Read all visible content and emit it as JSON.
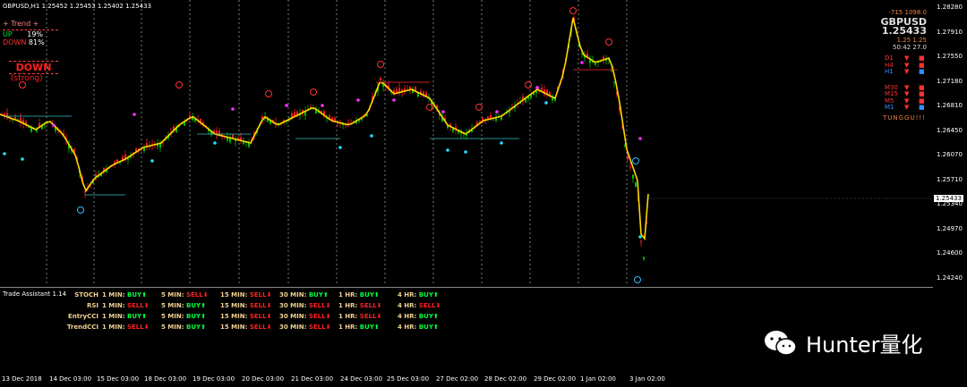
{
  "window_title": "GBPUSD,H1 1.25452 1.25453 1.25402 1.25433",
  "trend_panel": {
    "header": "+   Trend   +",
    "up_label": "UP",
    "up_value": "19%",
    "down_label": "DOWN",
    "down_value": "81%",
    "signal": "DOWN",
    "strength": "(strong)"
  },
  "symbol_panel": {
    "top_left": "-715",
    "top_right": "1098.0",
    "symbol": "GBPUSD",
    "price": "1.25433",
    "mid_left": "1.25",
    "mid_right": "1.25",
    "time_left": "50:42",
    "time_right": "27.0",
    "brand": "TUNGGU!!!"
  },
  "timeframes": [
    {
      "tf": "D1",
      "color": "#ff3030"
    },
    {
      "tf": "H4",
      "color": "#ff3030"
    },
    {
      "tf": "H1",
      "color": "#3090ff"
    },
    {
      "tf": "M30",
      "color": "#ff3030"
    },
    {
      "tf": "M15",
      "color": "#ff3030"
    },
    {
      "tf": "M5",
      "color": "#ff3030"
    },
    {
      "tf": "M1",
      "color": "#3090ff"
    }
  ],
  "price_axis": [
    "1.28280",
    "1.27910",
    "1.27550",
    "1.27180",
    "1.26810",
    "1.26450",
    "1.26070",
    "1.25710",
    "1.25340",
    "1.24970",
    "1.24600",
    "1.24240"
  ],
  "current_price": "1.25433",
  "time_axis": [
    "13 Dec 2018",
    "14 Dec 03:00",
    "15 Dec 03:00",
    "18 Dec 03:00",
    "19 Dec 03:00",
    "20 Dec 03:00",
    "21 Dec 03:00",
    "24 Dec 03:00",
    "25 Dec 03:00",
    "27 Dec 02:00",
    "28 Dec 02:00",
    "29 Dec 02:00",
    "1 Jan 02:00",
    "3 Jan 02:00"
  ],
  "assistant": {
    "title": "Trade Assistant 1.14",
    "rows": [
      {
        "name": "STOCH",
        "cells": [
          [
            "1 MIN:",
            "BUY",
            "buy"
          ],
          [
            "5 MIN:",
            "SELL",
            "sell"
          ],
          [
            "15 MIN:",
            "SELL",
            "sell"
          ],
          [
            "30 MIN:",
            "BUY",
            "buy"
          ],
          [
            "1 HR:",
            "BUY",
            "buy"
          ],
          [
            "4 HR:",
            "BUY",
            "buy"
          ]
        ]
      },
      {
        "name": "RSI",
        "cells": [
          [
            "1 MIN:",
            "SELL",
            "sell"
          ],
          [
            "5 MIN:",
            "BUY",
            "buy"
          ],
          [
            "15 MIN:",
            "SELL",
            "sell"
          ],
          [
            "30 MIN:",
            "SELL",
            "sell"
          ],
          [
            "1 HR:",
            "SELL",
            "sell"
          ],
          [
            "4 HR:",
            "SELL",
            "sell"
          ]
        ]
      },
      {
        "name": "EntryCCI",
        "cells": [
          [
            "1 MIN:",
            "BUY",
            "buy"
          ],
          [
            "5 MIN:",
            "BUY",
            "buy"
          ],
          [
            "15 MIN:",
            "SELL",
            "sell"
          ],
          [
            "30 MIN:",
            "SELL",
            "sell"
          ],
          [
            "1 HR:",
            "SELL",
            "sell"
          ],
          [
            "4 HR:",
            "BUY",
            "buy"
          ]
        ]
      },
      {
        "name": "TrendCCI",
        "cells": [
          [
            "1 MIN:",
            "SELL",
            "sell"
          ],
          [
            "5 MIN:",
            "BUY",
            "buy"
          ],
          [
            "15 MIN:",
            "SELL",
            "sell"
          ],
          [
            "30 MIN:",
            "SELL",
            "sell"
          ],
          [
            "1 HR:",
            "BUY",
            "buy"
          ],
          [
            "4 HR:",
            "BUY",
            "buy"
          ]
        ]
      }
    ]
  },
  "watermark": "Hunter量化",
  "colors": {
    "bull": "#00c000",
    "bear": "#ff2020",
    "ma": "#ffd700",
    "dotted": "#ffffff"
  }
}
